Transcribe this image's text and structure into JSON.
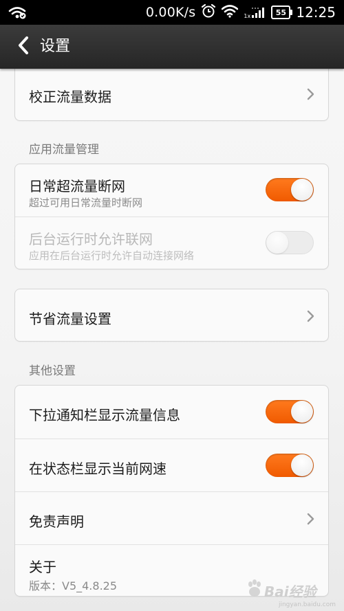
{
  "status_bar": {
    "net_speed": "0.00K/s",
    "time": "12:25",
    "battery": "55",
    "signal_label": "1x"
  },
  "header": {
    "title": "设置"
  },
  "rows": {
    "calibrate": {
      "title": "校正流量数据"
    },
    "daily_cutoff": {
      "title": "日常超流量断网",
      "subtitle": "超过可用日常流量时断网",
      "on": true
    },
    "background": {
      "title": "后台运行时允许联网",
      "subtitle": "应用在后台运行时允许自动连接网络",
      "on": false,
      "disabled": true
    },
    "save_settings": {
      "title": "节省流量设置"
    },
    "notify_bar": {
      "title": "下拉通知栏显示流量信息",
      "on": true
    },
    "status_speed": {
      "title": "在状态栏显示当前网速",
      "on": true
    },
    "disclaimer": {
      "title": "免责声明"
    },
    "about": {
      "title": "关于",
      "subtitle": "版本：V5_4.8.25"
    }
  },
  "sections": {
    "app_traffic": "应用流量管理",
    "other": "其他设置"
  },
  "watermark": {
    "brand": "Bai经验",
    "url": "jingyan.baidu.com"
  },
  "colors": {
    "accent": "#f26a10",
    "title_bar": "#2f2f2f"
  }
}
